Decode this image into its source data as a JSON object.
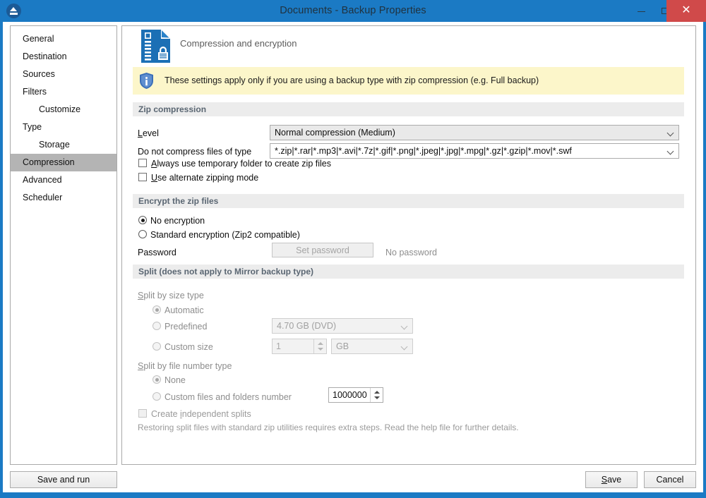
{
  "window": {
    "title": "Documents - Backup Properties",
    "app_icon": "eject-icon",
    "controls": {
      "minimize": "minimize-icon",
      "maximize": "maximize-icon",
      "close": "✕"
    }
  },
  "sidebar": {
    "items": [
      {
        "label": "General",
        "indent": false,
        "selected": false
      },
      {
        "label": "Destination",
        "indent": false,
        "selected": false
      },
      {
        "label": "Sources",
        "indent": false,
        "selected": false
      },
      {
        "label": "Filters",
        "indent": false,
        "selected": false
      },
      {
        "label": "Customize",
        "indent": true,
        "selected": false
      },
      {
        "label": "Type",
        "indent": false,
        "selected": false
      },
      {
        "label": "Storage",
        "indent": true,
        "selected": false
      },
      {
        "label": "Compression",
        "indent": false,
        "selected": true
      },
      {
        "label": "Advanced",
        "indent": false,
        "selected": false
      },
      {
        "label": "Scheduler",
        "indent": false,
        "selected": false
      }
    ]
  },
  "page": {
    "title": "Compression and encryption",
    "icon": "zip-document-lock-icon",
    "info_banner": {
      "icon": "info-shield-icon",
      "text": "These settings apply only if you are using a backup type with zip compression (e.g. Full backup)"
    }
  },
  "zip_compression": {
    "section_title": "Zip compression",
    "level_label": "Level",
    "level_mnemonic": "L",
    "level_value": "Normal compression (Medium)",
    "exclude_label": "Do not compress files of type",
    "exclude_value": "*.zip|*.rar|*.mp3|*.avi|*.7z|*.gif|*.png|*.jpeg|*.jpg|*.mpg|*.gz|*.gzip|*.mov|*.swf",
    "checkbox_temp_folder": {
      "label": "Always use temporary folder to create zip files",
      "mnemonic": "A",
      "checked": false
    },
    "checkbox_alternate_zip": {
      "label": "Use alternate zipping mode",
      "mnemonic": "U",
      "checked": false
    }
  },
  "encryption": {
    "section_title": "Encrypt the zip files",
    "option_none": {
      "label": "No encryption",
      "selected": true
    },
    "option_standard": {
      "label": "Standard encryption (Zip2 compatible)",
      "selected": false
    },
    "password_label": "Password",
    "set_password_button": "Set password",
    "password_status": "No password"
  },
  "split": {
    "section_title": "Split (does not apply to Mirror backup type)",
    "by_size_label": "Split by size type",
    "by_size_mnemonic": "S",
    "option_automatic": {
      "label": "Automatic",
      "selected": true
    },
    "option_predefined": {
      "label": "Predefined",
      "selected": false
    },
    "predefined_value": "4.70 GB (DVD)",
    "option_custom_size": {
      "label": "Custom size",
      "selected": false
    },
    "custom_size_value": "1",
    "custom_size_unit": "GB",
    "by_number_label": "Split by file number type",
    "by_number_mnemonic": "S",
    "option_none": {
      "label": "None",
      "selected": true
    },
    "option_custom_number": {
      "label": "Custom files and folders number",
      "selected": false
    },
    "custom_number_value": "1000000",
    "checkbox_independent": {
      "label": "Create independent splits",
      "mnemonic": "i",
      "checked": false
    },
    "note": "Restoring split files with standard zip utilities requires extra steps. Read the help file for further details."
  },
  "footer": {
    "save_and_run": "Save and run",
    "save": "Save",
    "save_mnemonic": "S",
    "cancel": "Cancel"
  }
}
